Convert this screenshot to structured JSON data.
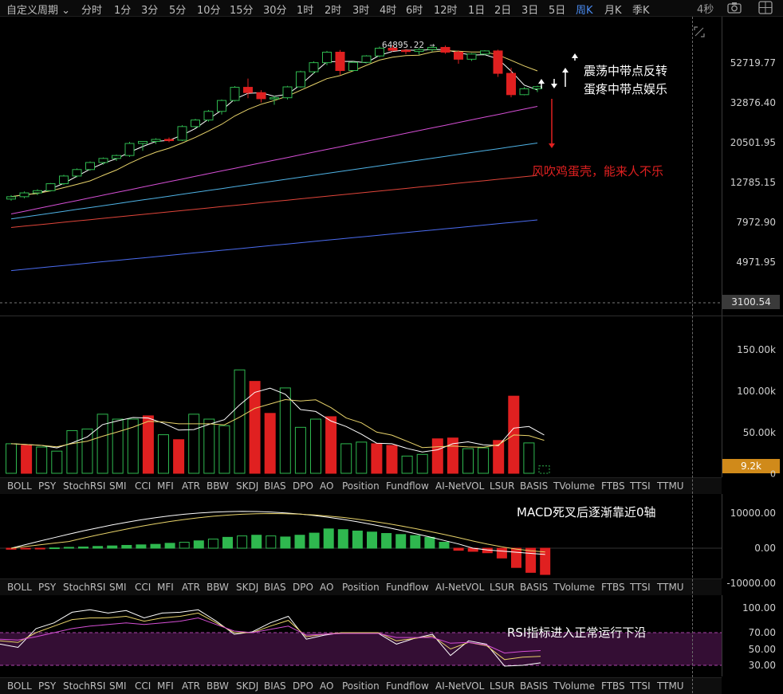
{
  "toolbar": {
    "items": [
      {
        "label": "自定义周期 ⌄",
        "active": false
      },
      {
        "label": "分时",
        "active": false
      },
      {
        "label": "1分",
        "active": false
      },
      {
        "label": "3分",
        "active": false
      },
      {
        "label": "5分",
        "active": false
      },
      {
        "label": "10分",
        "active": false
      },
      {
        "label": "15分",
        "active": false
      },
      {
        "label": "30分",
        "active": false
      },
      {
        "label": "1时",
        "active": false
      },
      {
        "label": "2时",
        "active": false
      },
      {
        "label": "3时",
        "active": false
      },
      {
        "label": "4时",
        "active": false
      },
      {
        "label": "6时",
        "active": false
      },
      {
        "label": "12时",
        "active": false
      },
      {
        "label": "1日",
        "active": false
      },
      {
        "label": "2日",
        "active": false
      },
      {
        "label": "3日",
        "active": false
      },
      {
        "label": "5日",
        "active": false
      },
      {
        "label": "周K",
        "active": true
      },
      {
        "label": "月K",
        "active": false
      },
      {
        "label": "季K",
        "active": false
      }
    ],
    "refresh": "4秒",
    "camera_icon": "camera-icon",
    "layout_icon": "grid-icon"
  },
  "colors": {
    "up": "#2fb84f",
    "down": "#e02020",
    "ma5": "#ffffff",
    "ma10": "#e8d36a",
    "ma20": "#d54fd5",
    "ma30": "#4fb3e6",
    "ma60": "#e0453a",
    "ma120": "#4b6cf0",
    "highlight_box": "#e0a020",
    "rsi_band": "#3a103a"
  },
  "indicator_tabs": [
    "BOLL",
    "PSY",
    "StochRSI",
    "SMI",
    "CCI",
    "MFI",
    "ATR",
    "BBW",
    "SKDJ",
    "BIAS",
    "DPO",
    "AO",
    "Position",
    "Fundflow",
    "AI-NetVOL",
    "LSUR",
    "BASIS",
    "TVolume",
    "FTBS",
    "TTSI",
    "TTMU"
  ],
  "chart_data": [
    {
      "type": "candlestick",
      "title": "",
      "y_scale": "log",
      "y_ticks": [
        "52719.77",
        "32876.40",
        "20501.95",
        "12785.15",
        "7972.90",
        "4971.95"
      ],
      "current_price_label": "3100.54",
      "max_label": "64895.22 →",
      "ohlc": [
        [
          10500,
          11000,
          10300,
          10800
        ],
        [
          10800,
          11500,
          10600,
          11300
        ],
        [
          11300,
          11800,
          11000,
          11600
        ],
        [
          11600,
          12700,
          11500,
          12600
        ],
        [
          12600,
          14000,
          12400,
          13800
        ],
        [
          13800,
          15100,
          13600,
          14900
        ],
        [
          14900,
          16400,
          14700,
          16200
        ],
        [
          16200,
          17200,
          15800,
          17000
        ],
        [
          17000,
          17800,
          16500,
          17600
        ],
        [
          17600,
          20700,
          17300,
          20300
        ],
        [
          20300,
          20900,
          18600,
          20800
        ],
        [
          20800,
          21600,
          20200,
          21300
        ],
        [
          21300,
          21800,
          20600,
          21100
        ],
        [
          21100,
          25200,
          20900,
          24800
        ],
        [
          24800,
          27200,
          24300,
          26800
        ],
        [
          26800,
          30200,
          26300,
          29700
        ],
        [
          29700,
          34200,
          28600,
          33800
        ],
        [
          33800,
          40100,
          33400,
          39500
        ],
        [
          39500,
          43800,
          34700,
          37100
        ],
        [
          37100,
          38200,
          33000,
          34500
        ],
        [
          34500,
          35700,
          32100,
          34900
        ],
        [
          34900,
          40200,
          34200,
          39700
        ],
        [
          39700,
          48100,
          39400,
          47500
        ],
        [
          47500,
          53700,
          46300,
          52900
        ],
        [
          52900,
          60800,
          51300,
          59900
        ],
        [
          59900,
          61500,
          45800,
          48200
        ],
        [
          48200,
          53700,
          47700,
          53100
        ],
        [
          53100,
          57800,
          52600,
          57300
        ],
        [
          57300,
          64000,
          56400,
          62800
        ],
        [
          62800,
          64900,
          60400,
          61200
        ],
        [
          61200,
          62200,
          58500,
          60400
        ],
        [
          60400,
          62900,
          58200,
          61800
        ],
        [
          61800,
          64200,
          60400,
          63400
        ],
        [
          63400,
          64800,
          58800,
          59900
        ],
        [
          59900,
          61200,
          52200,
          55100
        ],
        [
          55100,
          59200,
          54000,
          58600
        ],
        [
          58600,
          61300,
          57900,
          60800
        ],
        [
          60800,
          61700,
          44700,
          46600
        ],
        [
          46600,
          49800,
          35100,
          36200
        ],
        [
          36200,
          39600,
          35900,
          38800
        ],
        [
          38800,
          40300,
          37300,
          39800
        ]
      ],
      "ma_lines": [
        "MA5",
        "MA10",
        "MA20",
        "MA30",
        "MA60",
        "MA120"
      ],
      "annotations": [
        {
          "text": "震荡中带点反转",
          "color": "#ffffff"
        },
        {
          "text": "蛋疼中带点娱乐",
          "color": "#ffffff"
        },
        {
          "text": "风吹鸡蛋壳，能来人不乐",
          "color": "#e02020"
        }
      ]
    },
    {
      "type": "bar",
      "title": "Volume",
      "y_ticks": [
        "150.00k",
        "100.00k",
        "50.00k",
        "0"
      ],
      "current_label": "9.2k",
      "values": [
        36,
        34,
        32,
        27,
        52,
        54,
        72,
        66,
        66,
        70,
        47,
        41,
        72,
        66,
        58,
        126,
        112,
        73,
        104,
        56,
        66,
        69,
        36,
        38,
        36,
        34,
        21,
        23,
        42,
        43,
        30,
        31,
        40,
        94,
        37,
        9
      ],
      "ups": [
        1,
        0,
        1,
        1,
        1,
        1,
        1,
        1,
        1,
        0,
        1,
        0,
        1,
        1,
        1,
        1,
        0,
        0,
        1,
        1,
        1,
        0,
        1,
        1,
        0,
        0,
        1,
        1,
        0,
        0,
        1,
        1,
        0,
        0,
        1,
        1
      ]
    },
    {
      "type": "bar",
      "title": "MACD",
      "y_ticks": [
        "10000.00",
        "0.00",
        "-10000.00"
      ],
      "annotation": "MACD死叉后逐渐靠近0轴",
      "values": [
        -300,
        -200,
        -100,
        100,
        250,
        350,
        500,
        650,
        800,
        950,
        1100,
        1400,
        1700,
        2100,
        2600,
        3100,
        3500,
        3700,
        3500,
        3200,
        3700,
        4300,
        5500,
        5300,
        4900,
        4600,
        4200,
        3900,
        3600,
        3100,
        1700,
        -600,
        -900,
        -1300,
        -2800,
        -5500,
        -6900,
        -7500
      ]
    },
    {
      "type": "line",
      "title": "RSI",
      "y_ticks": [
        "100.00",
        "70.00",
        "50.00",
        "30.00"
      ],
      "annotation": "RSI指标进入正常运行下沿",
      "series": [
        {
          "name": "RSI6",
          "values": [
            56,
            52,
            75,
            82,
            95,
            98,
            94,
            97,
            88,
            94,
            95,
            98,
            84,
            68,
            71,
            82,
            90,
            62,
            67,
            70,
            70,
            69,
            56,
            63,
            68,
            42,
            60,
            56,
            29,
            30,
            33
          ]
        },
        {
          "name": "RSI12",
          "values": [
            60,
            58,
            70,
            78,
            86,
            88,
            88,
            90,
            84,
            88,
            90,
            94,
            82,
            70,
            70,
            78,
            85,
            65,
            68,
            70,
            70,
            70,
            60,
            63,
            66,
            50,
            58,
            54,
            37,
            40,
            41
          ]
        },
        {
          "name": "RSI24",
          "values": [
            62,
            61,
            65,
            70,
            75,
            78,
            80,
            82,
            80,
            82,
            84,
            88,
            80,
            72,
            70,
            74,
            78,
            67,
            68,
            69,
            69,
            69,
            64,
            64,
            64,
            57,
            58,
            55,
            45,
            47,
            48
          ]
        }
      ],
      "band": [
        30,
        70
      ]
    }
  ]
}
